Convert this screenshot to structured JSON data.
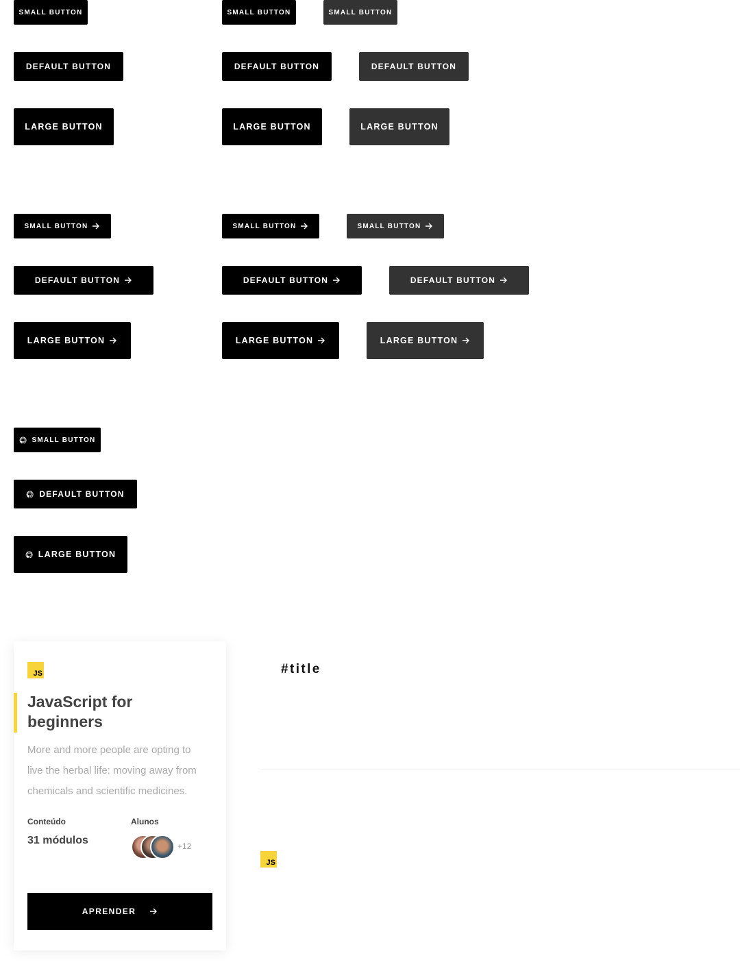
{
  "section1": {
    "row_small": [
      "SMALL BUTTON",
      "SMALL BUTTON",
      "SMALL BUTTON"
    ],
    "row_default": [
      "DEFAULT BUTTON",
      "DEFAULT BUTTON",
      "DEFAULT BUTTON"
    ],
    "row_large": [
      "LARGE BUTTON",
      "LARGE BUTTON",
      "LARGE BUTTON"
    ]
  },
  "section2": {
    "row_small": [
      "SMALL BUTTON",
      "SMALL BUTTON",
      "SMALL BUTTON"
    ],
    "row_default": [
      "DEFAULT BUTTON",
      "DEFAULT BUTTON",
      "DEFAULT BUTTON"
    ],
    "row_large": [
      "LARGE BUTTON",
      "LARGE BUTTON",
      "LARGE BUTTON"
    ]
  },
  "section3": {
    "small": "SMALL BUTTON",
    "default": "DEFAULT BUTTON",
    "large": "LARGE BUTTON"
  },
  "card": {
    "badge": "JS",
    "title": "JavaScript for beginners",
    "description": "More and more people are opting to live the herbal life: moving away from chemicals and scientific medicines.",
    "content_label": "Conteúdo",
    "content_value": "31 módulos",
    "students_label": "Alunos",
    "students_more": "+12",
    "button_label": "APRENDER"
  },
  "title_tag": "#title",
  "small_badge": "JS",
  "colors": {
    "black": "#000000",
    "dark": "#333333",
    "js_yellow": "#f7d43a",
    "muted_text": "#aaaaaa"
  },
  "icons": [
    "arrow-right-icon",
    "github-icon"
  ]
}
